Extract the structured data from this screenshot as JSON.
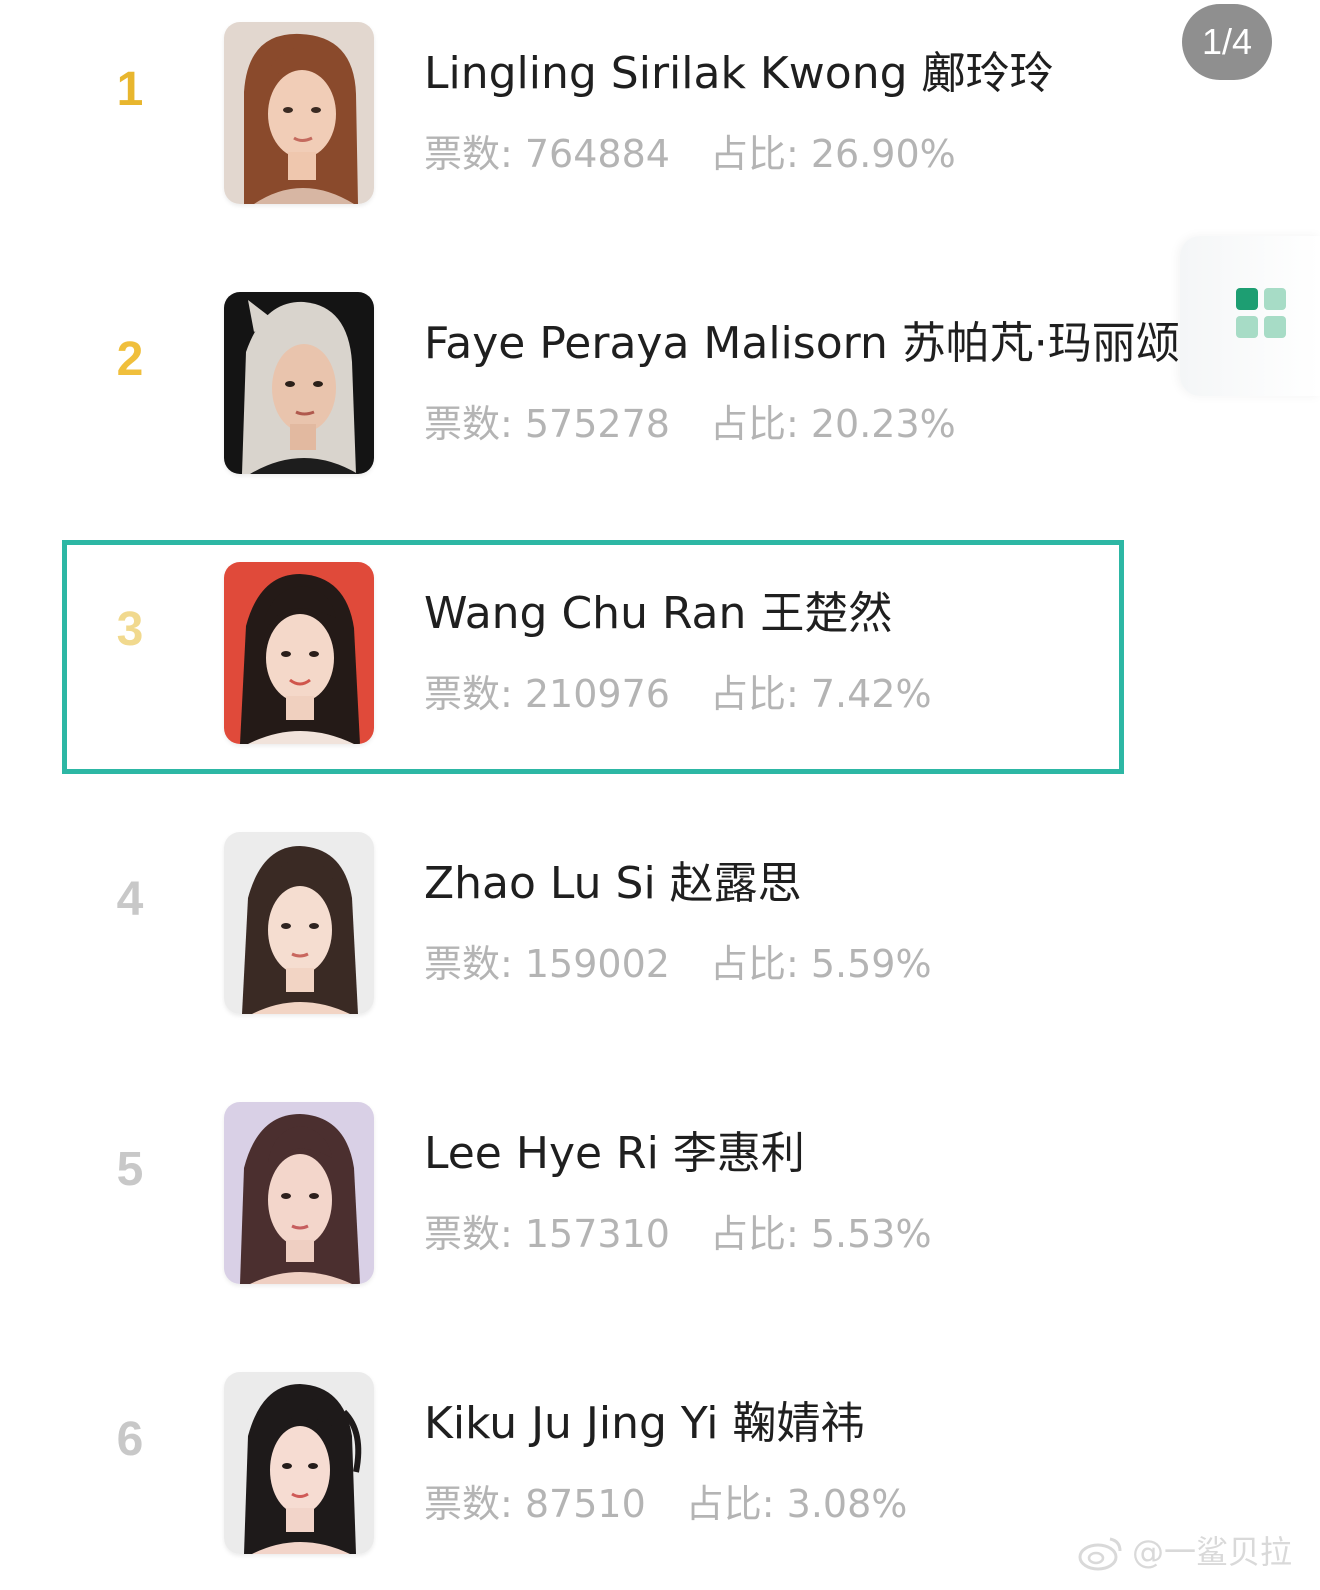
{
  "page_indicator": "1/4",
  "ranking": [
    {
      "rank": "1",
      "name": "Lingling Sirilak Kwong 鄺玲玲",
      "votes_label": "票数: 764884",
      "share_label": "占比: 26.90%",
      "votes": 764884,
      "share_percent": 26.9,
      "rank_color": "#e8b62e",
      "highlighted": false
    },
    {
      "rank": "2",
      "name": "Faye Peraya Malisorn 苏帕芃·玛丽颂",
      "votes_label": "票数: 575278",
      "share_label": "占比: 20.23%",
      "votes": 575278,
      "share_percent": 20.23,
      "rank_color": "#f0bf3c",
      "highlighted": false
    },
    {
      "rank": "3",
      "name": "Wang Chu Ran 王楚然",
      "votes_label": "票数: 210976",
      "share_label": "占比: 7.42%",
      "votes": 210976,
      "share_percent": 7.42,
      "rank_color": "#f1d98e",
      "highlighted": true
    },
    {
      "rank": "4",
      "name": "Zhao Lu Si 赵露思",
      "votes_label": "票数: 159002",
      "share_label": "占比: 5.59%",
      "votes": 159002,
      "share_percent": 5.59,
      "rank_color": "#c8c8c8",
      "highlighted": false
    },
    {
      "rank": "5",
      "name": "Lee Hye Ri 李惠利",
      "votes_label": "票数: 157310",
      "share_label": "占比: 5.53%",
      "votes": 157310,
      "share_percent": 5.53,
      "rank_color": "#c8c8c8",
      "highlighted": false
    },
    {
      "rank": "6",
      "name": "Kiku Ju Jing Yi 鞠婧祎",
      "votes_label": "票数: 87510",
      "share_label": "占比: 3.08%",
      "votes": 87510,
      "share_percent": 3.08,
      "rank_color": "#c8c8c8",
      "highlighted": false
    }
  ],
  "side_tab": {
    "icon": "grid-icon"
  },
  "watermark": {
    "icon": "weibo-icon",
    "text": "@一鲨贝拉"
  },
  "colors": {
    "highlight_border": "#2db7a4",
    "stats_text": "#b4b4b4",
    "name_text": "#1f1f1f"
  }
}
